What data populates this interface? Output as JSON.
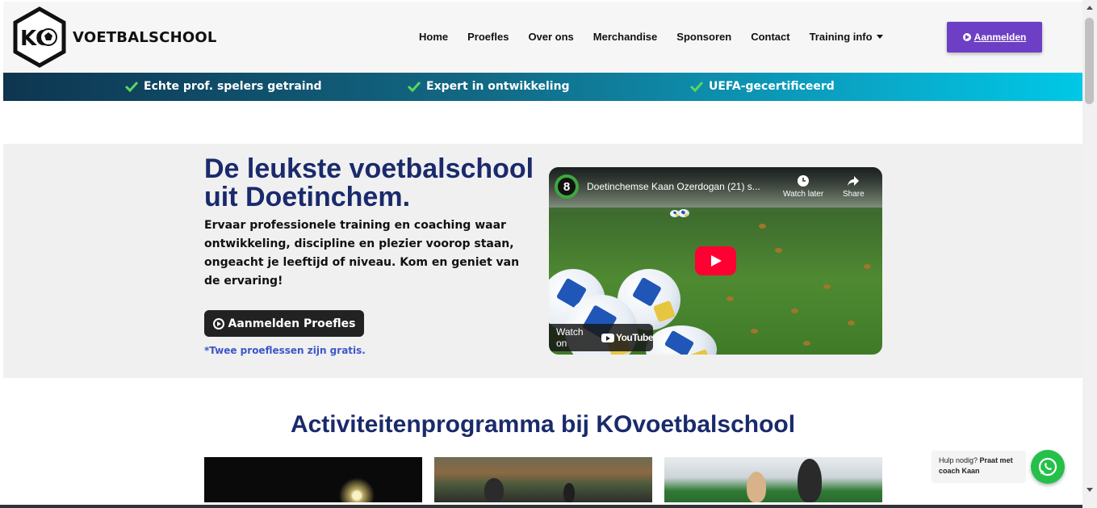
{
  "brand": {
    "logo_letters": "KO",
    "name": "VOETBALSCHOOL"
  },
  "nav": [
    {
      "label": "Home"
    },
    {
      "label": "Proefles"
    },
    {
      "label": "Over ons"
    },
    {
      "label": "Merchandise"
    },
    {
      "label": "Sponsoren"
    },
    {
      "label": "Contact"
    },
    {
      "label": "Training info"
    }
  ],
  "header_button": {
    "label": "Aanmelden"
  },
  "usps": [
    {
      "label": "Echte prof. spelers getraind"
    },
    {
      "label": "Expert in ontwikkeling"
    },
    {
      "label": "UEFA-gecertificeerd"
    }
  ],
  "hero": {
    "title": "De leukste voetbalschool uit Doetinchem.",
    "text": "Ervaar professionele training en coaching waar ontwikkeling, discipline en plezier voorop staan, ongeacht je leeftijd of niveau. Kom en geniet van de ervaring!",
    "cta_label": "Aanmelden Proefles",
    "note": "*Twee proeflessen zijn gratis."
  },
  "video": {
    "channel_number": "8",
    "title": "Doetinchemse Kaan Ozerdogan (21) s...",
    "watch_later": "Watch later",
    "share": "Share",
    "watch_on": "Watch on",
    "youtube": "YouTube"
  },
  "activities": {
    "title": "Activiteitenprogramma bij KOvoetbalschool"
  },
  "whatsapp": {
    "text_plain": "Hulp nodig? ",
    "text_bold": "Praat met coach Kaan"
  },
  "colors": {
    "accent_purple": "#6c3fc4",
    "heading_navy": "#1a2a6c",
    "whatsapp_green": "#25c04a",
    "note_blue": "#3d56c8"
  }
}
